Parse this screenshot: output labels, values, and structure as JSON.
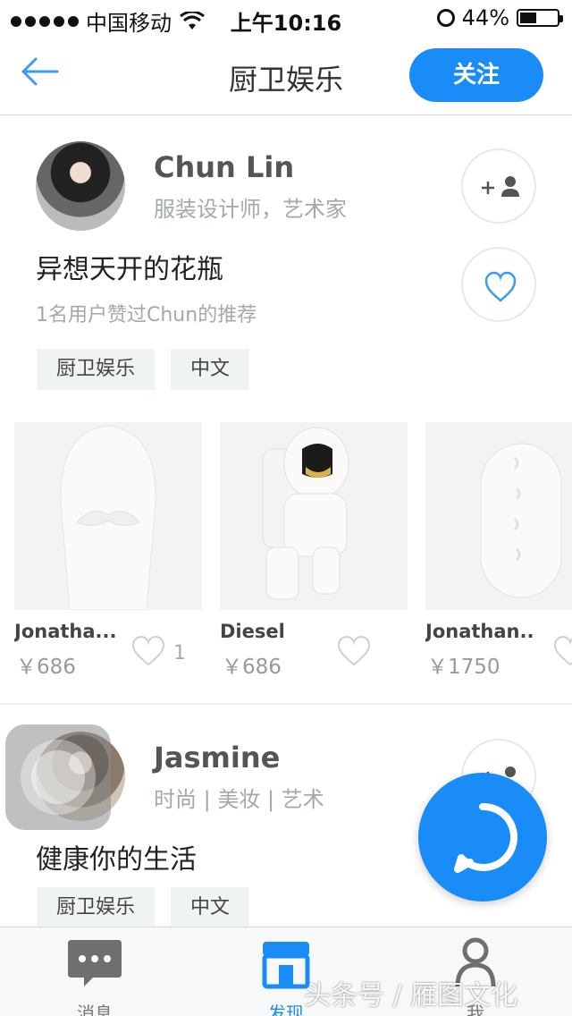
{
  "status_bar": {
    "carrier": "中国移动",
    "time": "上午10:16",
    "battery_percent": "44%",
    "battery_level": 0.44
  },
  "nav": {
    "title": "厨卫娱乐",
    "follow_label": "关注",
    "back_icon": "arrow-left-icon"
  },
  "cards": [
    {
      "user_name": "Chun Lin",
      "user_bio": "服装设计师，艺术家",
      "post_title": "异想天开的花瓶",
      "likes_text": "1名用户赞过Chun的推荐",
      "tags": [
        "厨卫娱乐",
        "中文"
      ],
      "products": [
        {
          "name": "Jonatha...",
          "price": "￥686",
          "like_count": "1"
        },
        {
          "name": "Diesel",
          "price": "￥686",
          "like_count": ""
        },
        {
          "name": "Jonathan...",
          "price": "￥1750",
          "like_count": ""
        }
      ]
    },
    {
      "user_name": "Jasmine",
      "user_bio": "时尚 | 美妆 | 艺术",
      "post_title": "健康你的生活",
      "tags": [
        "厨卫娱乐",
        "中文"
      ]
    }
  ],
  "tabs": [
    {
      "label": "消息",
      "icon": "chat-bubble-icon"
    },
    {
      "label": "发现",
      "icon": "store-icon",
      "active": true
    },
    {
      "label": "我",
      "icon": "person-icon"
    }
  ],
  "watermark": "头条号 / 雁图文化",
  "colors": {
    "accent": "#1a8cf7",
    "tag_bg": "#f0f3f4",
    "muted_text": "#a2a9ad"
  }
}
